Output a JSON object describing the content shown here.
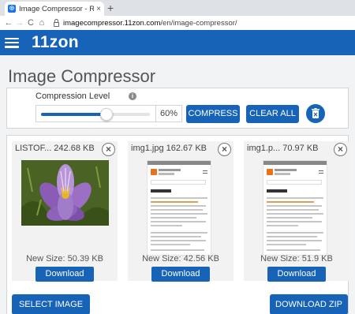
{
  "browser": {
    "tab_title": "Image Compressor - Reduce Ima",
    "tab_close": "×",
    "new_tab": "+",
    "url_host": "imagecompressor.11zon.com",
    "url_path": "/en/image-compressor/",
    "nav": {
      "back": "←",
      "forward": "→",
      "reload": "C",
      "home": "⌂"
    }
  },
  "header": {
    "brand": "11zon"
  },
  "page": {
    "title": "Image Compressor"
  },
  "controls": {
    "compression_label": "Compression Level",
    "info": "i",
    "compression_level": 0.6,
    "percent_text": "60%",
    "compress_label": "COMPRESS",
    "clear_all_label": "CLEAR ALL"
  },
  "files": [
    {
      "name": "LISTOF...   242.68 KB",
      "new_size": "New Size: 50.39 KB",
      "download": "Download",
      "thumbnail": "flower-photo",
      "close": "×"
    },
    {
      "name": "img1.jpg   162.67 KB",
      "new_size": "New Size: 42.56 KB",
      "download": "Download",
      "thumbnail": "document-screenshot",
      "close": "×"
    },
    {
      "name": "img1.p...   70.97 KB",
      "new_size": "New Size: 51.9 KB",
      "download": "Download",
      "thumbnail": "document-screenshot",
      "close": "×"
    }
  ],
  "actions": {
    "select_image": "SELECT IMAGE",
    "download_zip": "DOWNLOAD ZIP"
  },
  "colors": {
    "brand_blue": "#1763b7",
    "chrome_bg": "#dee1e6",
    "page_bg": "#f1f3f4"
  }
}
